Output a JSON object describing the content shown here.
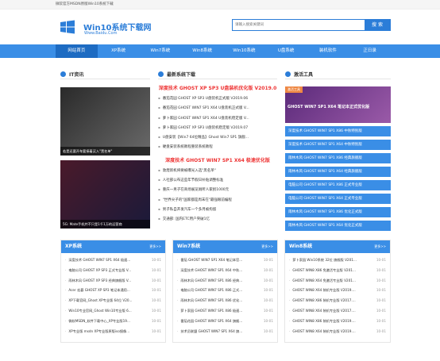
{
  "topbar": {
    "text": "微软官方MSDN原版Win10系统下载"
  },
  "header": {
    "site_title": "Win10系统下载网",
    "site_url": "Www.Baidu.Com"
  },
  "search": {
    "placeholder": "请输入搜索关键词",
    "button": "搜 索"
  },
  "nav": [
    "网站首页",
    "XP系统",
    "Win7系统",
    "Win8系统",
    "Win10系统",
    "U盘系统",
    "装机软件",
    "正日录"
  ],
  "it_news": {
    "title": "IT资讯",
    "img1_caption": "若是还要开车要接着买入\"黑名单\"",
    "img2_caption": "5G: Mate手机并不只是1千1万的运营商"
  },
  "latest": {
    "title": "最新系统下载",
    "headline1": "深度技术 GHOST XP SP3 U盘装机优化版 V2019.0",
    "list1": [
      "番茄花园 GHOST XP SP3 U盘装机正式版 V2019.06",
      "番茄花园 GHOST WIN7 SP1 X64 U盘装机正式版 V...",
      "萝卜家园 GHOST WIN7 SP1 X64 U盘装机稳定版 V...",
      "萝卜家园 GHOST XP SP3 U盘装机稳定版 V2019.07",
      "U盘安装【Win7 64位精品】Ghost Win7 SP1 旗舰...",
      "硬盘安装系统教程重装系统教程"
    ],
    "headline2": "深度技术 GHOST WIN7 SP1 X64 极速优化版",
    "list2": [
      "敦煌新机将要被曝光入选\"黑名单\"",
      "人社部公布这些年节假日补贴调整标准",
      "重庆一男子在商场展览厕所人家损1000元",
      "\"世界尖子的\"国家都是周末在\"最强眼前编程",
      "男子私自开发汽车一个多月被拘留",
      "交通部: 国内ETC用户突破1亿"
    ]
  },
  "tools": {
    "title": "激活工具",
    "badge": "激活工具",
    "top_title": "GHOST WIN7 SP1 X64 笔记本正式优化版",
    "items": [
      "深度技术 GHOST WIN7 SP1 X86 中秋特别版",
      "深度技术 GHOST WIN7 SP1 X64 中秋特别版",
      "雨林木风 GHOST WIN7 SP1 X86 经典旗舰版",
      "雨林木风 GHOST WIN7 SP1 X64 经典旗舰版",
      "电脑公司 GHOST WIN7 SP1 X86 正式专业版",
      "电脑公司 GHOST WIN7 SP1 X64 正式专业版",
      "雨林木风 GHOST WIN7 SP1 X86 优化正式版",
      "雨林木风 GHOST WIN7 SP1 X64 优化正式版"
    ]
  },
  "xp": {
    "title": "XP系统",
    "more": "更多>>",
    "items": [
      [
        "深度技术 GHOST WIN7 SP1 X64 极速...",
        "10-01"
      ],
      [
        "电脑公司 GHOST XP SP3 正式专业版 V...",
        "10-01"
      ],
      [
        "雨林木风 GHOST XP SP3 经典旗舰版 V...",
        "10-01"
      ],
      [
        "Acer 宏碁 GHOST XP SP3 笔记本通用...",
        "10-01"
      ],
      [
        "XP下载官网_Ghost XP专业版 64位 V20...",
        "10-01"
      ],
      [
        "Win10专业官网_Ghost Win10专业版 6...",
        "10-01"
      ],
      [
        "微软MSDN_软件下载中心_XP专业版19...",
        "10-01"
      ],
      [
        "XP专业版 msdn XP专业版原版iso镜像...",
        "10-01"
      ]
    ]
  },
  "win7": {
    "title": "Win7系统",
    "more": "更多>>",
    "items": [
      [
        "番茄 GHOST WIN7 SP1 X64 笔记本官...",
        "10-01"
      ],
      [
        "深度技术 GHOST WIN7 SP1 X64 中秋...",
        "10-01"
      ],
      [
        "雨林木风 GHOST WIN7 SP1 X86 经典...",
        "10-01"
      ],
      [
        "电脑公司 GHOST WIN7 SP1 X86 正式...",
        "10-01"
      ],
      [
        "雨林木风 GHOST WIN7 SP1 X86 优化...",
        "10-01"
      ],
      [
        "萝卜家园 GHOST WIN7 SP1 X86 极速...",
        "10-01"
      ],
      [
        "番茄花园 GHOST WIN7 SP1 X64 旗舰...",
        "10-01"
      ],
      [
        "技术员联盟 GHOST WIN7 SP1 X64 旗...",
        "10-01"
      ]
    ]
  },
  "win8": {
    "title": "Win8系统",
    "more": "更多>>",
    "items": [
      [
        "萝卜家园 Win10系统 32位 旗舰版 V201...",
        "10-01"
      ],
      [
        "GHOST WIN8 X86 免激活专业版 V201...",
        "10-01"
      ],
      [
        "GHOST WIN8 X64 免激活专业版 V201...",
        "10-01"
      ],
      [
        "GHOST WIN8 X64 装机专业版 V2019....",
        "10-01"
      ],
      [
        "GHOST WIN8 X86 装机专业版 V2017....",
        "10-01"
      ],
      [
        "GHOST WIN8 X64 装机专业版 V2017....",
        "10-01"
      ],
      [
        "GHOST WIN8 X86 装机专业版 V2019....",
        "10-01"
      ],
      [
        "GHOST WIN8 X64 装机专业版 V2019....",
        "10-01"
      ]
    ]
  }
}
